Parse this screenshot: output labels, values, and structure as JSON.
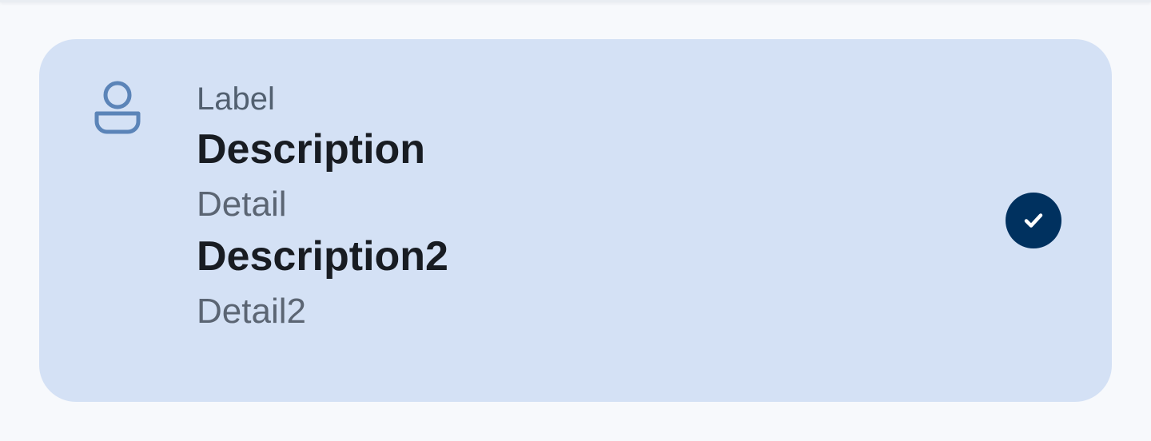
{
  "card": {
    "label": "Label",
    "description_1": "Description",
    "detail_1": "Detail",
    "description_2": "Description2",
    "detail_2": "Detail2",
    "leading_icon": "person-icon",
    "trailing_icon": "check-circle-icon",
    "selected": true
  },
  "colors": {
    "background": "#f7f9fc",
    "card_background": "#d4e1f5",
    "icon_blue": "#5b84b8",
    "check_circle": "#00315f",
    "label_text": "#526070",
    "description_text": "#181c22",
    "detail_text": "#5b6573"
  }
}
